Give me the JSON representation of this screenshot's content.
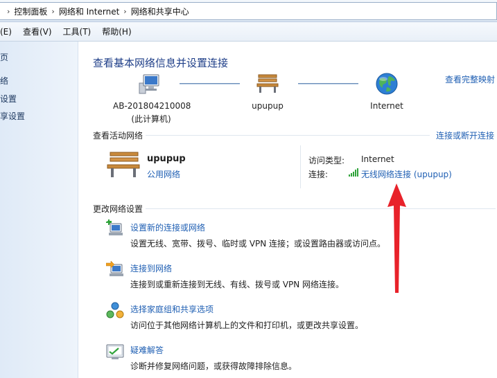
{
  "breadcrumb": {
    "items": [
      "控制面板",
      "网络和 Internet",
      "网络和共享中心"
    ]
  },
  "menu": [
    "(E)",
    "查看(V)",
    "工具(T)",
    "帮助(H)"
  ],
  "left_pane": {
    "links": [
      "页",
      "络",
      "设置",
      "享设置"
    ]
  },
  "main": {
    "title": "查看基本网络信息并设置连接",
    "full_map_link": "查看完整映射",
    "map": {
      "computer_name": "AB-201804210008",
      "computer_sub": "(此计算机)",
      "network_name": "upupup",
      "internet_label": "Internet"
    },
    "active_section": {
      "label": "查看活动网络",
      "connect_link": "连接或断开连接",
      "network_name": "upupup",
      "network_type": "公用网络",
      "access_type_label": "访问类型:",
      "access_type_value": "Internet",
      "connection_label": "连接:",
      "connection_value": "无线网络连接 (upupup)"
    },
    "change_section": {
      "label": "更改网络设置",
      "tasks": [
        {
          "title": "设置新的连接或网络",
          "desc": "设置无线、宽带、拨号、临时或 VPN 连接；或设置路由器或访问点。"
        },
        {
          "title": "连接到网络",
          "desc": "连接到或重新连接到无线、有线、拨号或 VPN 网络连接。"
        },
        {
          "title": "选择家庭组和共享选项",
          "desc": "访问位于其他网络计算机上的文件和打印机，或更改共享设置。"
        },
        {
          "title": "疑难解答",
          "desc": "诊断并修复网络问题，或获得故障排除信息。"
        }
      ]
    }
  },
  "colors": {
    "link": "#1f5fb3",
    "title": "#1e3e88",
    "annotation_arrow": "#e8222a"
  }
}
